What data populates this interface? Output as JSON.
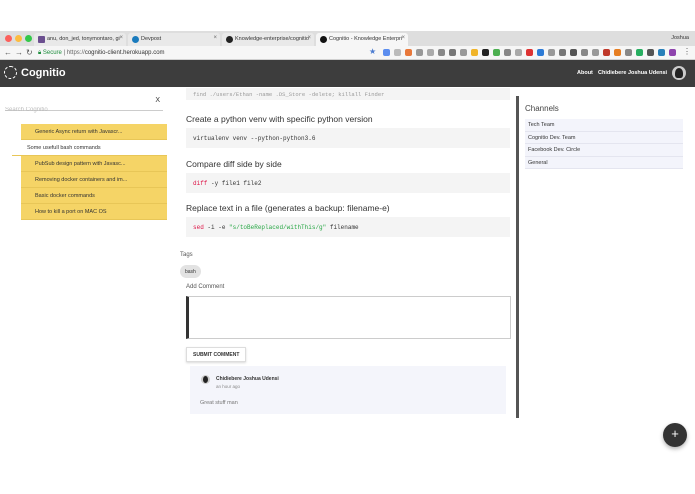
{
  "browser": {
    "tabs": [
      {
        "label": "anu, don_jed, tonymontaro, gi",
        "icon": "stackoverflow-favicon-icon"
      },
      {
        "label": "Devpost",
        "icon": "devpost-favicon-icon"
      },
      {
        "label": "Knowledge-enterprise/cognitio",
        "icon": "github-favicon-icon"
      },
      {
        "label": "Cognitio - Knowledge Enterpri",
        "icon": "cognitio-favicon-icon"
      }
    ],
    "profile_name": "Joshua",
    "secure_label": "Secure",
    "url_scheme": "https://",
    "url_host": "cognitio-client.herokuapp.com"
  },
  "header": {
    "logo": "Cognitio",
    "about": "About",
    "user_name": "Chidiebere Joshua Udensi"
  },
  "sidebar": {
    "search_placeholder": "Search Cognitio",
    "clear": "X",
    "items": [
      {
        "label": "Generic Async return with Javascr..."
      },
      {
        "label": "Some usefull bash commands"
      },
      {
        "label": "PubSub design pattern with Javasc..."
      },
      {
        "label": "Removing docker containers and im..."
      },
      {
        "label": "Basic docker commands"
      },
      {
        "label": "How to kill a port on MAC OS"
      }
    ]
  },
  "main": {
    "top_code": "find ./users/Ethan -name .DS_Store -delete; killall Finder",
    "sections": [
      {
        "title": "Create a python venv with specific python version",
        "code": "virtualenv venv --python-python3.6"
      },
      {
        "title": "Compare diff side by side",
        "code_kw": "diff",
        "code_rest": " -y file1 file2"
      },
      {
        "title": "Replace text in a file (generates a backup: filename-e)",
        "code_kw": "sed",
        "code_mid": " -i -e ",
        "code_str": "\"s/toBeReplaced/withThis/g\"",
        "code_tail": " filename"
      }
    ],
    "tags_label": "Tags",
    "tags": [
      "bash"
    ],
    "add_comment_label": "Add Comment",
    "submit_label": "SUBMIT COMMENT",
    "comment": {
      "author": "Chidiebere Joshua Udensi",
      "time": "an hour ago",
      "text": "Great stuff man"
    }
  },
  "channels": {
    "title": "Channels",
    "items": [
      "Tech Team",
      "Cognitio Dev. Team",
      "Facebook Dev. Circle",
      "General"
    ]
  },
  "fab_label": "+",
  "colors": {
    "accent_yellow": "#f5d466",
    "header_dark": "#3d3d3d",
    "channel_bg": "#f3f4fb"
  }
}
